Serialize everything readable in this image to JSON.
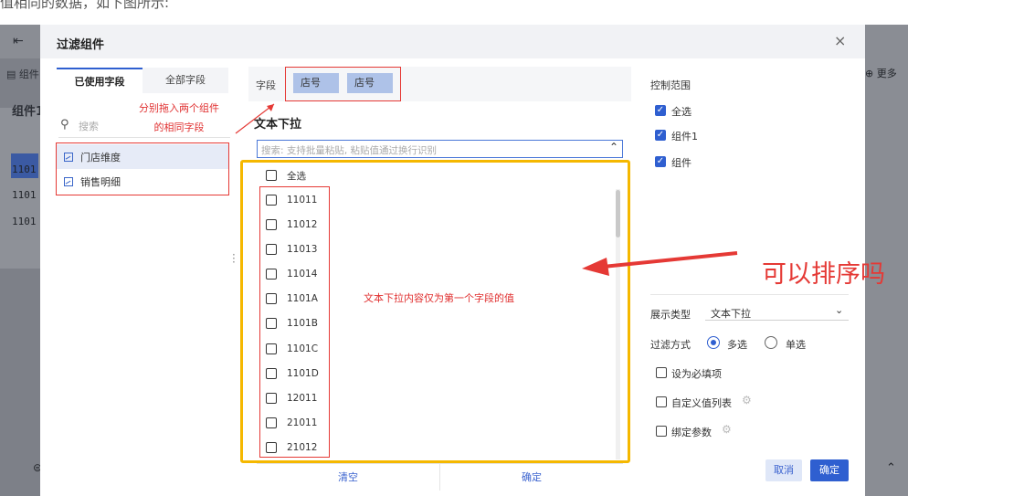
{
  "article": {
    "top_text": "值相同的数据，如下图所示:"
  },
  "backdrop": {
    "toolbar_left_label": "组件",
    "more_label": "更多",
    "panel_title": "组件1",
    "row_values": [
      "1101",
      "1101",
      "1101"
    ]
  },
  "modal": {
    "title": "过滤组件",
    "close": "×",
    "tabs": {
      "used_fields": "已使用字段",
      "all_fields": "全部字段"
    },
    "search_placeholder": "搜索",
    "field_items": [
      "门店维度",
      "销售明细"
    ],
    "annotation_left": "分别拖入两个组件的相同字段",
    "annotation_left_line1": "分别拖入两个组件",
    "annotation_left_line2": "的相同字段",
    "field_label": "字段",
    "chips": [
      "店号",
      "店号"
    ],
    "widget_title": "文本下拉",
    "list_search_placeholder": "搜索: 支持批量粘贴, 粘贴值通过换行识别",
    "select_all": "全选",
    "list_values": [
      "11011",
      "11012",
      "11013",
      "11014",
      "1101A",
      "1101B",
      "1101C",
      "1101D",
      "12011",
      "21011",
      "21012"
    ],
    "annotation_center": "文本下拉内容仅为第一个字段的值",
    "clear_button": "清空",
    "confirm_list_button": "确定",
    "control_scope_label": "控制范围",
    "scope_options": [
      "全选",
      "组件1",
      "组件"
    ],
    "display_type_label": "展示类型",
    "display_type_value": "文本下拉",
    "filter_mode_label": "过滤方式",
    "filter_options": [
      "多选",
      "单选"
    ],
    "required_label": "设为必填项",
    "custom_list_label": "自定义值列表",
    "bind_param_label": "绑定参数",
    "cancel_button": "取消",
    "ok_button": "确定"
  },
  "annotation_big": "可以排序吗",
  "colors": {
    "accent": "#2f5fd0",
    "annotation_red": "#e53935",
    "highlight_yellow": "#f5b800"
  }
}
